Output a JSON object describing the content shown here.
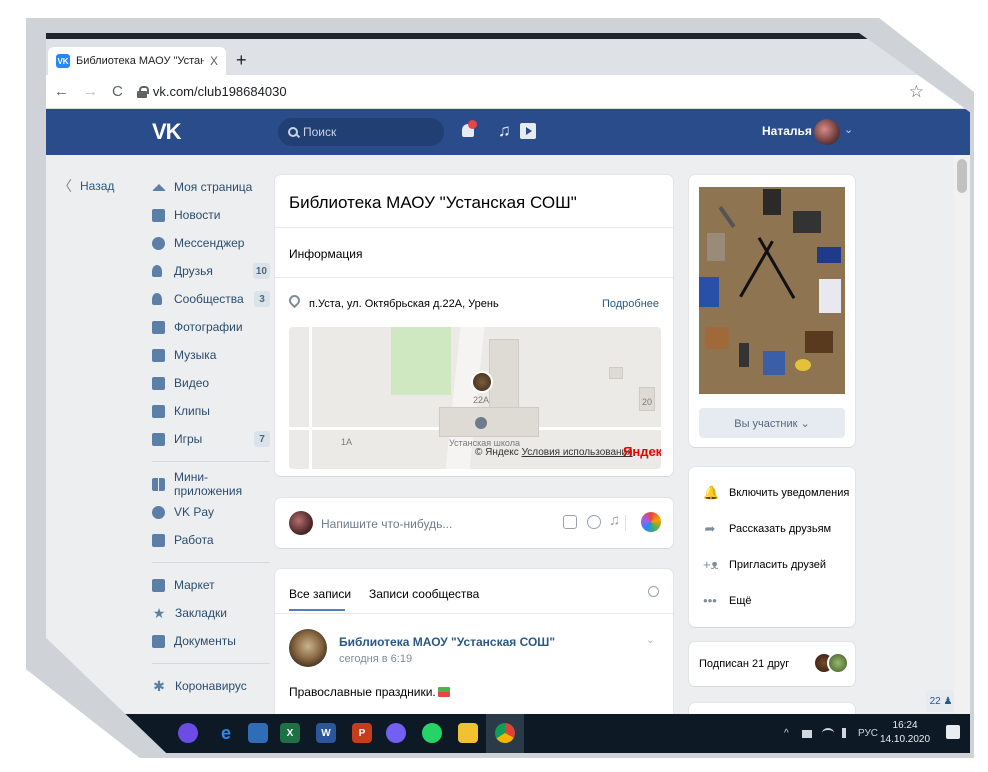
{
  "browser": {
    "tab_title": "Библиотека МАОУ \"Устанская С",
    "tab_close": "X",
    "new_tab": "+",
    "nav_back": "←",
    "nav_forward": "→",
    "nav_reload": "C",
    "url": "vk.com/club198684030",
    "star": "☆"
  },
  "vk_header": {
    "logo": "VK",
    "search_placeholder": "Поиск",
    "music": "♫",
    "user_name": "Наталья",
    "chevron": "⌄"
  },
  "back": {
    "chevron": "〈",
    "label": "Назад"
  },
  "sidebar": {
    "items": [
      {
        "label": "Моя страница"
      },
      {
        "label": "Новости"
      },
      {
        "label": "Мессенджер"
      },
      {
        "label": "Друзья",
        "badge": "10"
      },
      {
        "label": "Сообщества",
        "badge": "3"
      },
      {
        "label": "Фотографии"
      },
      {
        "label": "Музыка"
      },
      {
        "label": "Видео"
      },
      {
        "label": "Клипы"
      },
      {
        "label": "Игры",
        "badge": "7"
      }
    ],
    "items2": [
      {
        "label": "Мини-приложения"
      },
      {
        "label": "VK Pay"
      },
      {
        "label": "Работа"
      }
    ],
    "items3": [
      {
        "label": "Маркет"
      },
      {
        "label": "Закладки"
      },
      {
        "label": "Документы"
      }
    ],
    "items4": [
      {
        "label": "Коронавирус"
      }
    ],
    "icons": {
      "star": "★",
      "virus": "✱"
    }
  },
  "group": {
    "title": "Библиотека МАОУ \"Устанская СОШ\"",
    "info_heading": "Информация",
    "address": "п.Уста, ул. Октябрьская д.22А, Урень",
    "more_link": "Подробнее",
    "map": {
      "label_1a": "1А",
      "label_20": "20",
      "label_22a": "22А",
      "label_school": "Устанская школа",
      "attr_prefix": "© Яндекс",
      "attr_link": "Условия использования",
      "yandex_logo": "Яндекс"
    }
  },
  "compose": {
    "placeholder": "Напишите что-нибудь...",
    "music": "♫"
  },
  "wall": {
    "tab_all": "Все записи",
    "tab_community": "Записи сообщества",
    "post": {
      "author": "Библиотека МАОУ \"Устанская СОШ\"",
      "time": "сегодня в 6:19",
      "text": "Православные праздники.",
      "chevron": "⌄"
    }
  },
  "right": {
    "member_button": "Вы участник ⌄",
    "actions": [
      {
        "icon": "🔔",
        "label": "Включить уведомления"
      },
      {
        "icon": "➦",
        "label": "Рассказать друзьям"
      },
      {
        "icon": "+ᴥ",
        "label": "Пригласить друзей"
      },
      {
        "icon": "•••",
        "label": "Ещё"
      }
    ],
    "friends_text": "Подписан 21 друг",
    "widget_count": "22 ♟"
  },
  "taskbar": {
    "xl": "X",
    "wd": "W",
    "pp": "P",
    "tray_arrow": "^",
    "tray_lang": "РУС",
    "time": "16:24",
    "date": "14.10.2020"
  }
}
